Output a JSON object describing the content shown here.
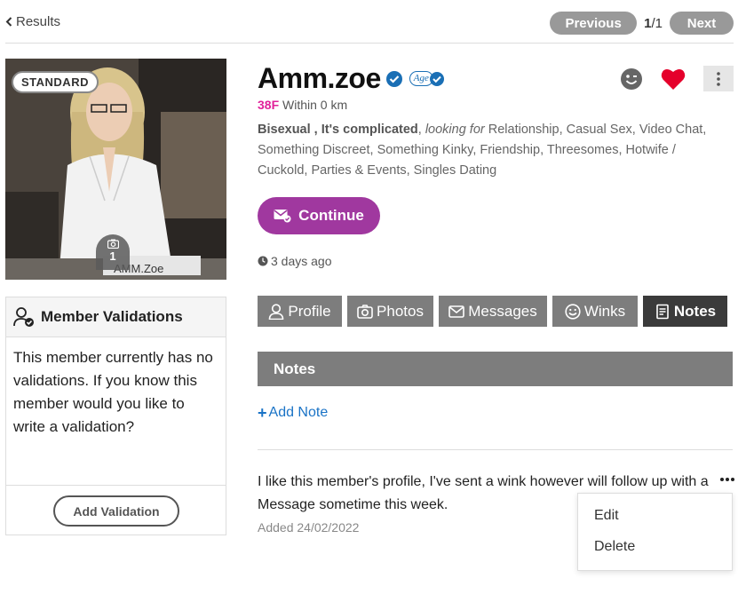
{
  "nav": {
    "back_label": "Results",
    "previous_label": "Previous",
    "page_current": "1",
    "page_total": "/1",
    "next_label": "Next"
  },
  "profile": {
    "badge": "STANDARD",
    "photo_count": "1",
    "photo_caption": "AMM.Zoe",
    "name": "Amm.zoe",
    "age_badge": "Age",
    "age_gender": "38F",
    "distance": "Within 0 km",
    "orientation": "Bisexual",
    "status": "It's complicated",
    "looking_for_label": "looking for",
    "looking_for": "Relationship, Casual Sex, Video Chat, Something Discreet, Something Kinky, Friendship, Threesomes, Hotwife / Cuckold, Parties & Events, Singles Dating",
    "continue_label": "Continue",
    "last_seen": "3 days ago"
  },
  "validations": {
    "title": "Member Validations",
    "text": "This member currently has no validations. If you know this member would you like to write a validation?",
    "button_label": "Add Validation"
  },
  "tabs": [
    {
      "label": "Profile",
      "icon": "user-icon"
    },
    {
      "label": "Photos",
      "icon": "camera-icon"
    },
    {
      "label": "Messages",
      "icon": "envelope-icon"
    },
    {
      "label": "Winks",
      "icon": "smile-icon"
    },
    {
      "label": "Notes",
      "icon": "note-icon",
      "active": true
    }
  ],
  "notes": {
    "header": "Notes",
    "add_label": "Add Note",
    "note_text": "I like this member's profile, I've sent a wink however will follow up with a Message sometime this week.",
    "note_date": "Added 24/02/2022",
    "menu": {
      "edit_label": "Edit",
      "delete_label": "Delete"
    }
  },
  "colors": {
    "accent_purple": "#a0389f",
    "age_gender_pink": "#e0219a",
    "link_blue": "#1a73c6",
    "heart_red": "#e5002b",
    "tab_gray": "#7d7d7d",
    "tab_active": "#3b3b3b"
  }
}
